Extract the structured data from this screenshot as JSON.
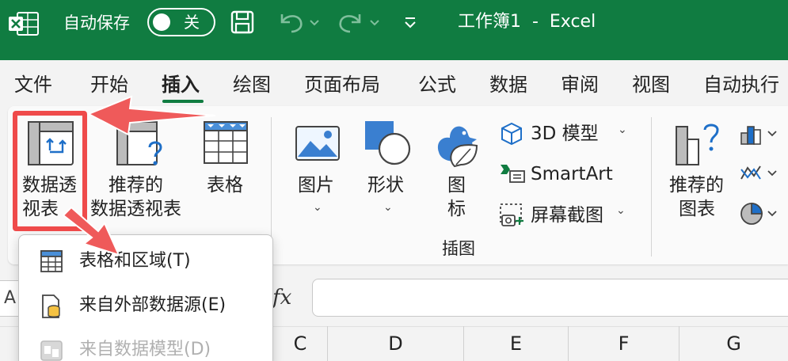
{
  "titlebar": {
    "app_icon": "excel-icon",
    "autosave_label": "自动保存",
    "autosave_state": "关",
    "doc_title": "工作簿1  -  Excel",
    "icons": [
      "save-icon",
      "undo-icon",
      "redo-icon",
      "customize-quick-access-icon"
    ]
  },
  "menu": {
    "tabs": [
      "文件",
      "开始",
      "插入",
      "绘图",
      "页面布局",
      "公式",
      "数据",
      "审阅",
      "视图",
      "自动执行"
    ],
    "active": "插入"
  },
  "ribbon": {
    "pivot_table": {
      "line1": "数据透",
      "line2": "视表"
    },
    "recommended_pivot": {
      "line1": "推荐的",
      "line2": "数据透视表"
    },
    "table": "表格",
    "picture": "图片",
    "shapes": "形状",
    "icons": {
      "line1": "图",
      "line2": "标"
    },
    "model3d": "3D 模型",
    "smartart": "SmartArt",
    "screenshot": "屏幕截图",
    "illustrations_group": "插图",
    "recommended_charts": {
      "line1": "推荐的",
      "line2": "图表"
    },
    "accent_color": "#107c41",
    "highlight_color": "#ef4a4a"
  },
  "dropdown": {
    "items": [
      {
        "label": "表格和区域(T)",
        "icon": "table-range-icon",
        "enabled": true
      },
      {
        "label": "来自外部数据源(E)",
        "icon": "external-data-icon",
        "enabled": true
      },
      {
        "label": "来自数据模型(D)",
        "icon": "data-model-icon",
        "enabled": false
      }
    ]
  },
  "formula_bar": {
    "namebox": "A",
    "fx": "fx"
  },
  "columns": [
    "C",
    "D",
    "E",
    "F",
    "G"
  ]
}
